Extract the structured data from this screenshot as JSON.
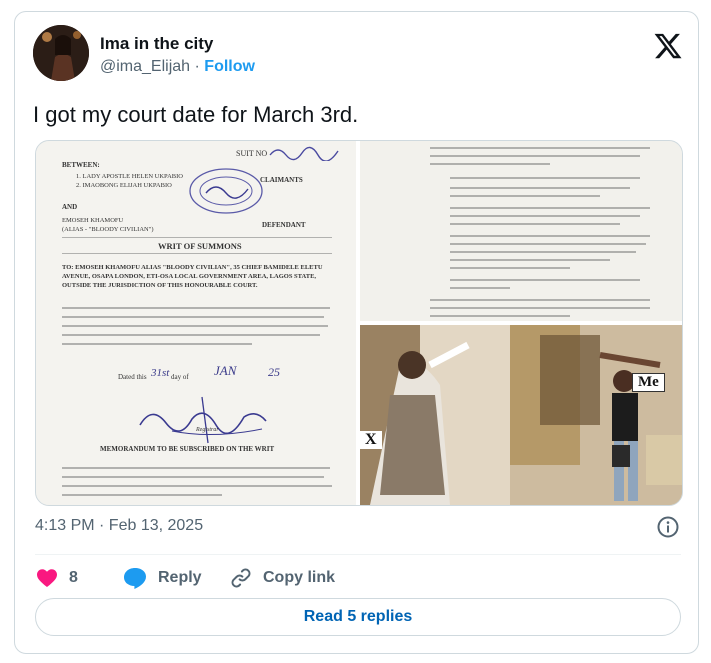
{
  "author": {
    "name": "Ima in the city",
    "handle": "@ima_Elijah",
    "separator": "·",
    "follow_label": "Follow"
  },
  "tweet": {
    "text": "I got my court date for March 3rd."
  },
  "media": {
    "doc_left": {
      "suit_no": "SUIT NO",
      "between": "BETWEEN:",
      "claimant1": "1. LADY APOSTLE HELEN UKPABIO",
      "claimant2": "2. IMAOBONG ELIJAH UKPABIO",
      "claimants_label": "CLAIMANTS",
      "and": "AND",
      "defendant_name": "EMOSEH KHAMOFU",
      "defendant_alias": "(ALIAS - \"BLOODY CIVILIAN\")",
      "defendant_label": "DEFENDANT",
      "title": "WRIT OF SUMMONS",
      "addressee": "TO: EMOSEH KHAMOFU ALIAS \"BLOODY CIVILIAN\", 35 CHIEF BAMIDELE ELETU AVENUE, OSAPA LONDON, ETI-OSA LOCAL GOVERNMENT AREA, LAGOS STATE, OUTSIDE THE JURISDICTION OF THIS HONOURABLE COURT.",
      "dated_label": "Dated this",
      "dated_day": "31st",
      "dated_of": "day of",
      "dated_month": "JAN",
      "dated_year": "25",
      "registrar": "Registrar",
      "memo": "MEMORANDUM TO BE SUBSCRIBED ON THE WRIT"
    },
    "photo": {
      "label_me": "Me",
      "label_x": "X"
    }
  },
  "meta": {
    "timestamp": "4:13 PM · Feb 13, 2025"
  },
  "actions": {
    "like_count": "8",
    "reply_label": "Reply",
    "copy_label": "Copy link"
  },
  "read_replies": "Read 5 replies",
  "colors": {
    "accent": "#1d9bf0",
    "like": "#f91880",
    "replies_text": "#0064b4"
  }
}
